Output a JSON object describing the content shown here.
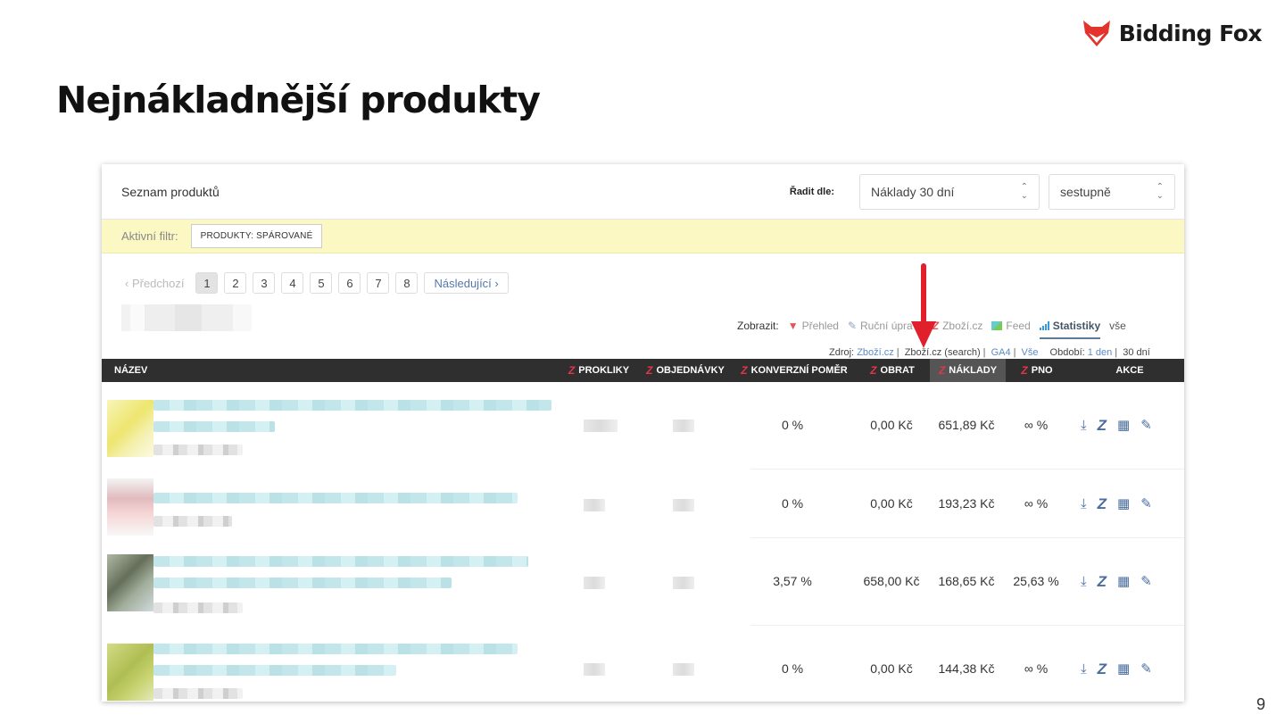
{
  "brand": {
    "name": "Bidding Fox",
    "color": "#e4332d"
  },
  "slide": {
    "title": "Nejnákladnější produkty",
    "page": "9"
  },
  "panel": {
    "title": "Seznam produktů",
    "sort_label": "Řadit dle:",
    "sort_value": "Náklady 30 dní",
    "order_value": "sestupně"
  },
  "filter": {
    "label": "Aktivní filtr:",
    "chip": "PRODUKTY: SPÁROVANÉ"
  },
  "pagination": {
    "prev": "‹ Předchozí",
    "pages": [
      "1",
      "2",
      "3",
      "4",
      "5",
      "6",
      "7",
      "8"
    ],
    "active_page": "1",
    "next": "Následující ›"
  },
  "views": {
    "label": "Zobrazit:",
    "items": [
      "Přehled",
      "Ruční úpravy",
      "Zboží.cz",
      "Feed",
      "Statistiky",
      "vše"
    ],
    "active": "Statistiky"
  },
  "source": {
    "label": "Zdroj:",
    "items": [
      "Zboží.cz",
      "Zboží.cz (search)",
      "GA4",
      "Vše"
    ],
    "active": "Zboží.cz (search)",
    "period_label": "Období:",
    "periods": [
      "1 den",
      "30 dní"
    ],
    "active_period": "30 dní"
  },
  "columns": [
    "NÁZEV",
    "PROKLIKY",
    "OBJEDNÁVKY",
    "KONVERZNÍ POMĚR",
    "OBRAT",
    "NÁKLADY",
    "PNO",
    "AKCE"
  ],
  "rows": [
    {
      "konverze": "0 %",
      "obrat": "0,00 Kč",
      "naklady": "651,89 Kč",
      "pno": "∞ %"
    },
    {
      "konverze": "0 %",
      "obrat": "0,00 Kč",
      "naklady": "193,23 Kč",
      "pno": "∞ %"
    },
    {
      "konverze": "3,57 %",
      "obrat": "658,00 Kč",
      "naklady": "168,65 Kč",
      "pno": "25,63 %"
    },
    {
      "konverze": "0 %",
      "obrat": "0,00 Kč",
      "naklady": "144,38 Kč",
      "pno": "∞ %"
    }
  ],
  "actions": [
    "download-icon",
    "zbozi-icon",
    "store-icon",
    "pencil-icon"
  ],
  "colors": {
    "header_bg": "#2f2f2f",
    "filter_bg": "#fbf8c4",
    "accent_red": "#e4344a",
    "link_blue": "#5d8ac2",
    "arrow": "#e0202a"
  }
}
